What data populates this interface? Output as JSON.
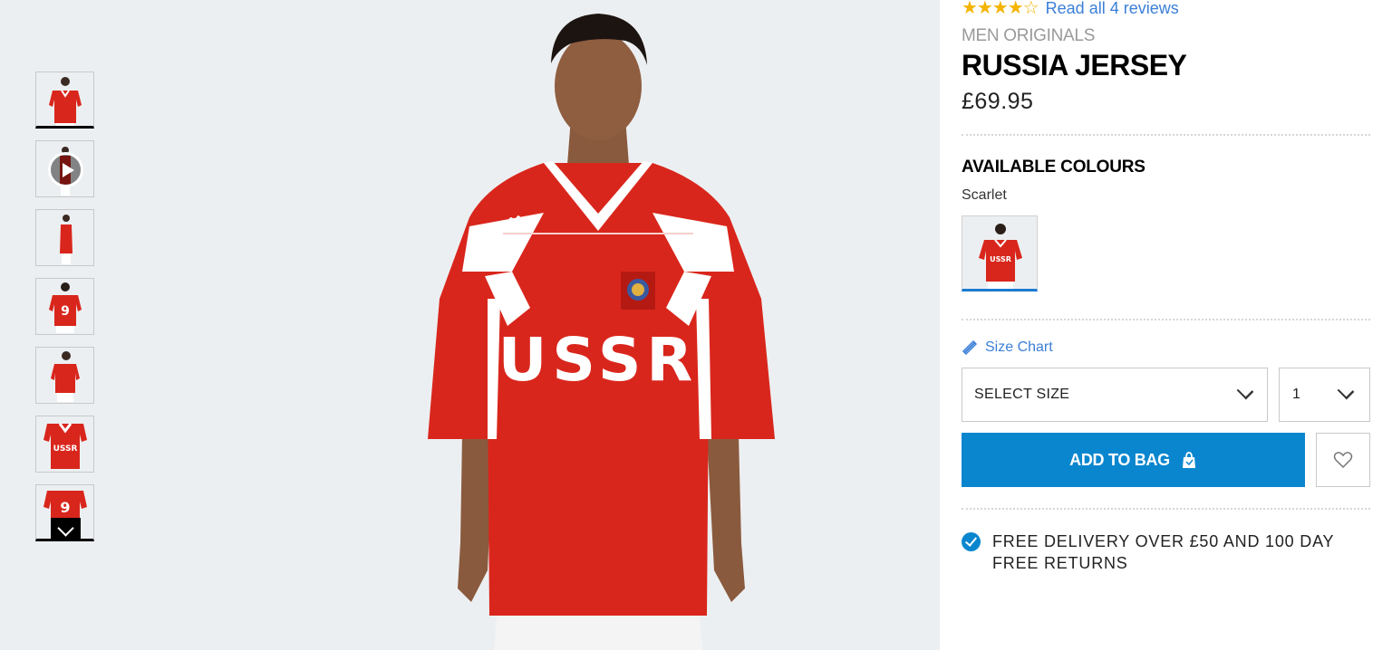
{
  "gallery": {
    "thumbnails": [
      {
        "view": "front",
        "active": true
      },
      {
        "view": "video",
        "has_play": true
      },
      {
        "view": "side"
      },
      {
        "view": "back"
      },
      {
        "view": "front-angle"
      },
      {
        "view": "detail"
      },
      {
        "view": "back-detail"
      }
    ],
    "main_image": "model-wearing-red-ussr-jersey",
    "jersey_text": "USSR"
  },
  "product": {
    "rating_stars": "★★★★☆",
    "rating": 4,
    "reviews_link": "Read all 4 reviews",
    "category": "MEN ORIGINALS",
    "title": "RUSSIA JERSEY",
    "price": "£69.95"
  },
  "colours": {
    "heading": "AVAILABLE COLOURS",
    "selected": "Scarlet"
  },
  "size_chart_label": "Size Chart",
  "size_select": {
    "label": "SELECT SIZE"
  },
  "quantity_select": {
    "value": "1"
  },
  "add_to_bag": {
    "label": "ADD TO BAG"
  },
  "delivery": {
    "text": "FREE DELIVERY OVER £50 AND 100 DAY FREE RETURNS"
  },
  "colors": {
    "primary_blue": "#0a86cf",
    "link_blue": "#3b7fd8",
    "jersey_red": "#d9261c",
    "gallery_bg": "#eceff1"
  }
}
